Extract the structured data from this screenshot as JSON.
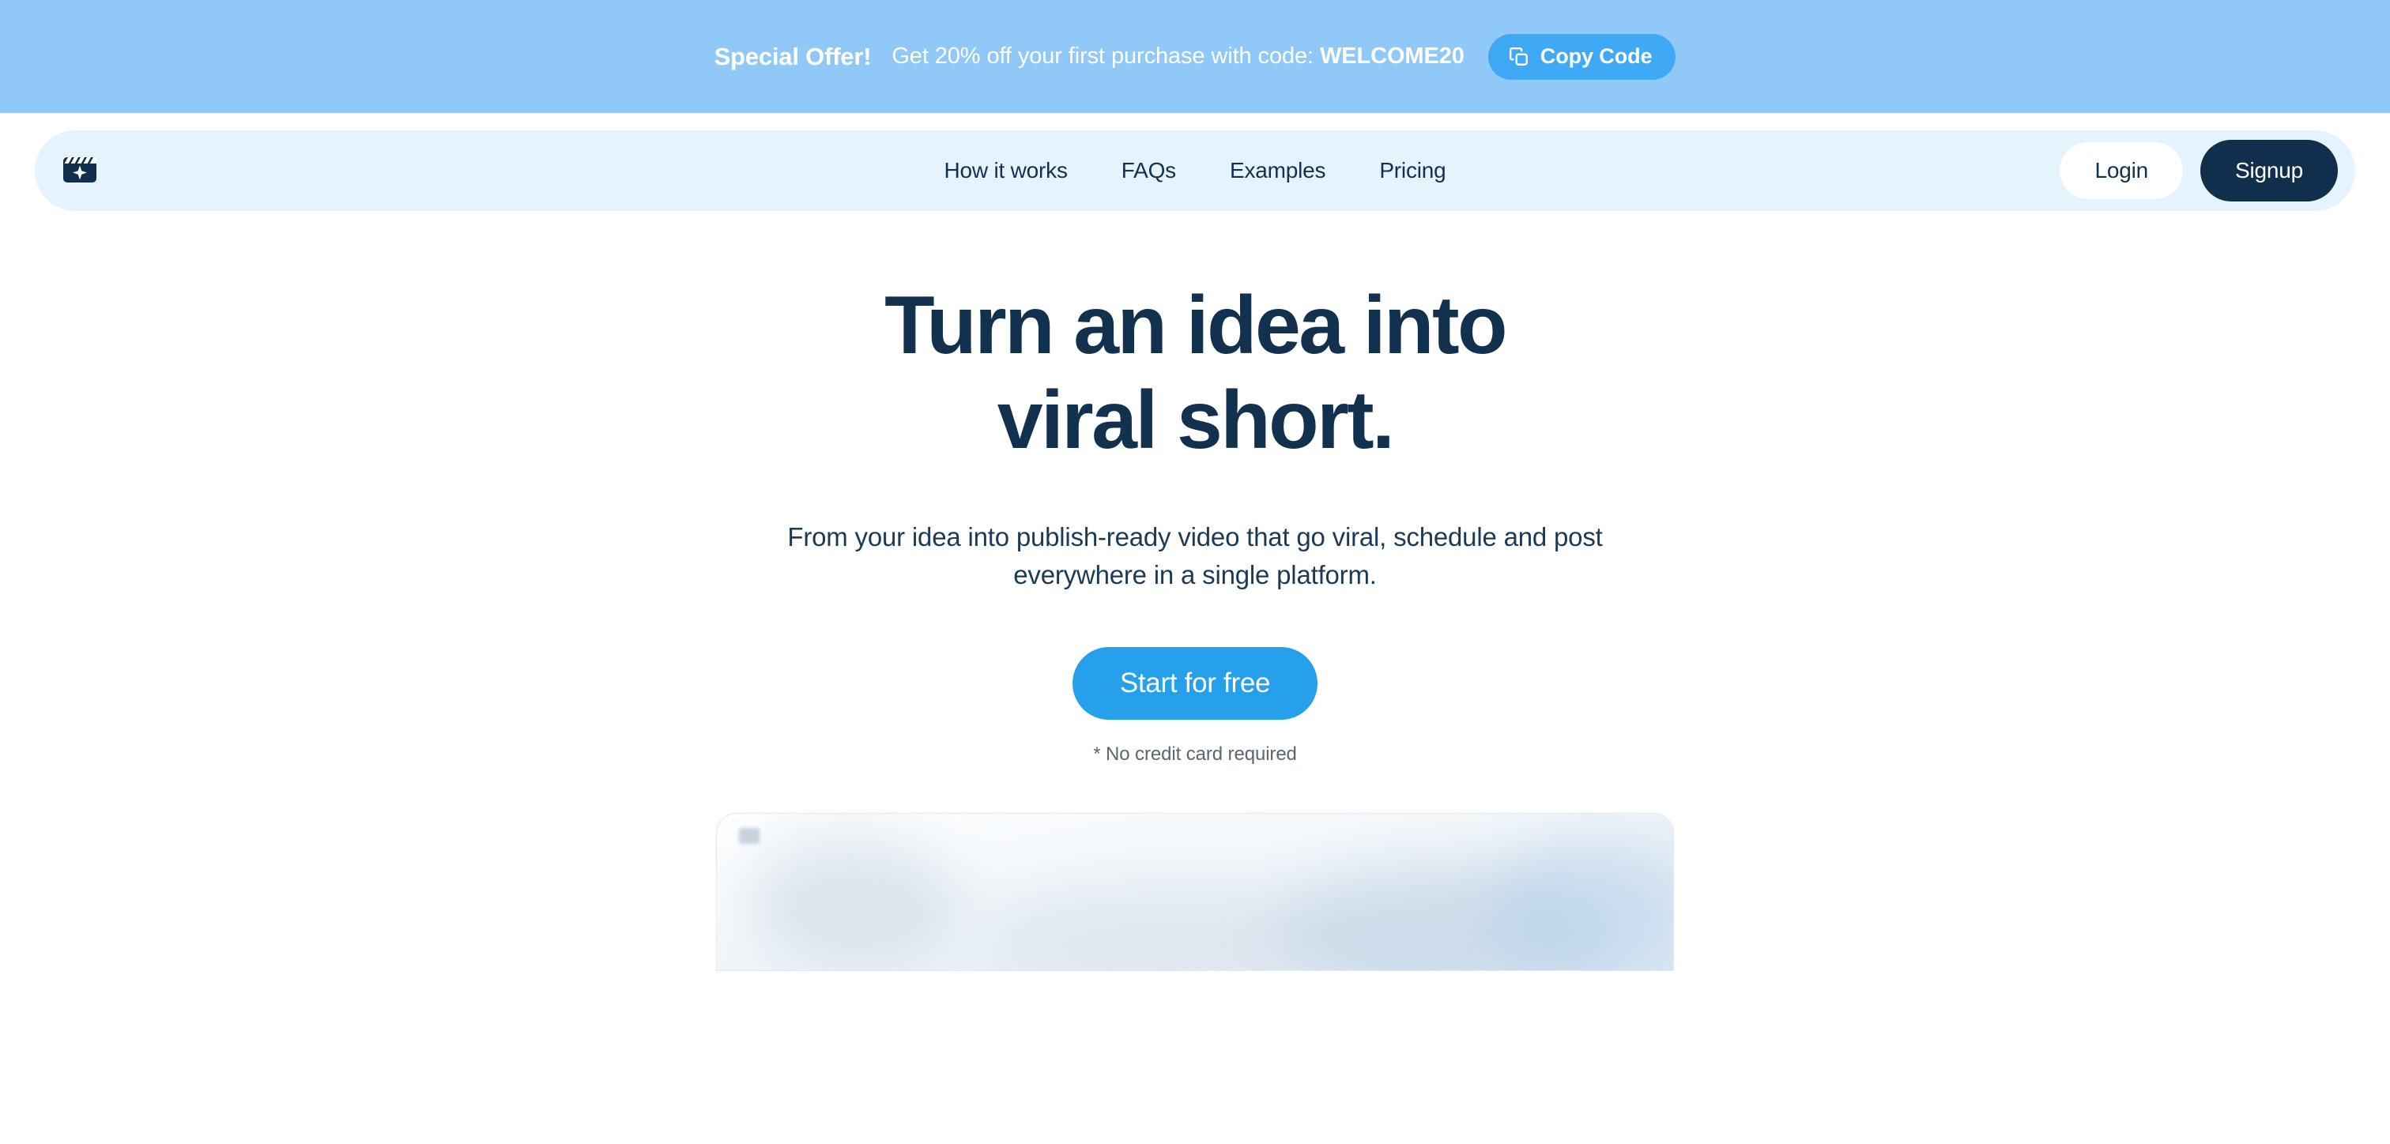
{
  "promo": {
    "headline": "Special Offer!",
    "message": "Get 20% off your first purchase with code:",
    "code": "WELCOME20",
    "copy_button_label": "Copy Code",
    "copy_icon": "copy-icon",
    "background_color": "#90C9F8",
    "button_color": "#3FA9F5"
  },
  "nav": {
    "logo_icon": "clapperboard-sparkle-icon",
    "background_color": "#E5F3FD",
    "links": [
      {
        "label": "How it works"
      },
      {
        "label": "FAQs"
      },
      {
        "label": "Examples"
      },
      {
        "label": "Pricing"
      }
    ],
    "login_label": "Login",
    "signup_label": "Signup",
    "login_color": "#FFFFFF",
    "signup_color": "#102F4D"
  },
  "hero": {
    "title_line_1": "Turn an idea into",
    "title_line_2": "viral short.",
    "subtitle": "From your idea into publish-ready video that go viral, schedule and post everywhere in a single platform.",
    "cta_label": "Start for free",
    "cta_color": "#27A0EC",
    "cta_note": "* No credit card required",
    "title_color": "#12314E"
  },
  "preview": {
    "state": "blurred-preview-card"
  }
}
